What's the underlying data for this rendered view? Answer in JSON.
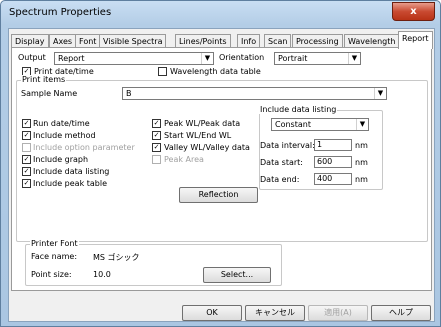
{
  "window": {
    "title": "Spectrum Properties",
    "close_label": "x"
  },
  "tabs": [
    "Display",
    "Axes",
    "Font",
    "Visible Spectra",
    "Lines/Points",
    "Info",
    "Scan",
    "Processing",
    "Wavelength",
    "Report"
  ],
  "active_tab": "Report",
  "output": {
    "label": "Output",
    "value": "Report"
  },
  "orientation": {
    "label": "Orientation",
    "value": "Portrait"
  },
  "print_datetime": {
    "label": "Print date/time",
    "checked": true
  },
  "wavelength_table": {
    "label": "Wavelength data table",
    "checked": false
  },
  "print_items": {
    "legend": "Print items",
    "sample_name_label": "Sample Name",
    "sample_name_value": "B",
    "left_items": [
      {
        "label": "Run date/time",
        "checked": true,
        "disabled": false
      },
      {
        "label": "Include method",
        "checked": true,
        "disabled": false
      },
      {
        "label": "Include option parameter",
        "checked": false,
        "disabled": true
      },
      {
        "label": "Include graph",
        "checked": true,
        "disabled": false
      },
      {
        "label": "Include data listing",
        "checked": true,
        "disabled": false
      },
      {
        "label": "Include peak table",
        "checked": true,
        "disabled": false
      }
    ],
    "mid_items": [
      {
        "label": "Peak WL/Peak data",
        "checked": true,
        "disabled": false
      },
      {
        "label": "Start WL/End WL",
        "checked": true,
        "disabled": false
      },
      {
        "label": "Valley WL/Valley data",
        "checked": true,
        "disabled": false
      },
      {
        "label": "Peak Area",
        "checked": false,
        "disabled": true
      }
    ],
    "reflection_button": "Reflection"
  },
  "data_listing": {
    "legend": "Include data listing",
    "mode": "Constant",
    "interval_label": "Data interval:",
    "interval_value": "1",
    "start_label": "Data start:",
    "start_value": "600",
    "end_label": "Data end:",
    "end_value": "400",
    "unit": "nm"
  },
  "printer_font": {
    "legend": "Printer Font",
    "face_label": "Face name:",
    "face_value": "MS ゴシック",
    "size_label": "Point size:",
    "size_value": "10.0",
    "select_button": "Select..."
  },
  "buttons": {
    "ok": "OK",
    "cancel": "キャンセル",
    "apply": "適用(A)",
    "help": "ヘルプ"
  },
  "check_mark": "✓"
}
